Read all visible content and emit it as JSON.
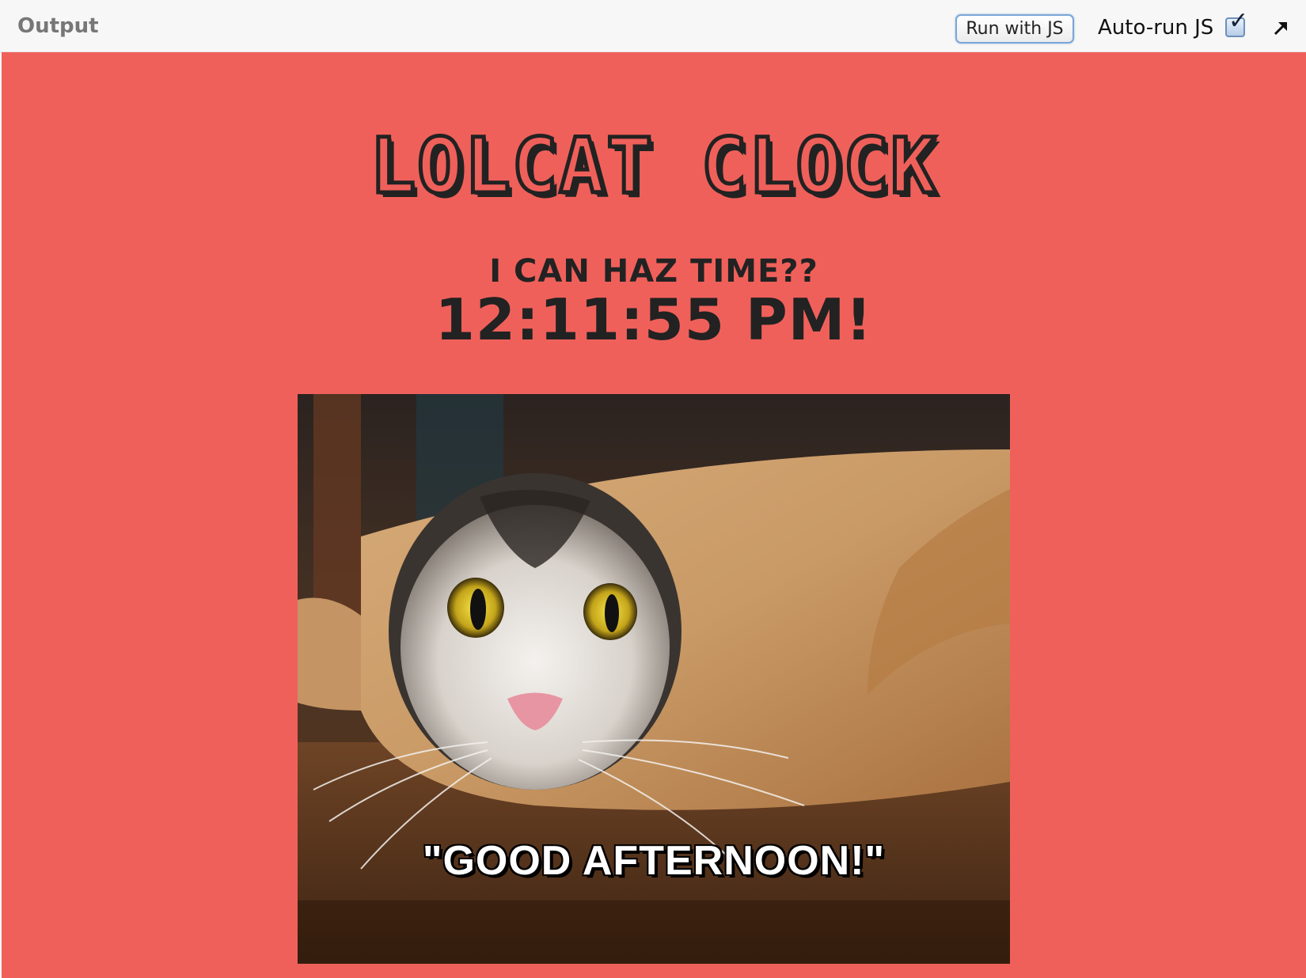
{
  "toolbar": {
    "title": "Output",
    "run_button_label": "Run with JS",
    "autorun_label": "Auto-run JS",
    "autorun_checked": true,
    "popout_icon": "external-link-arrow-icon"
  },
  "app": {
    "title": "LOLCAT CLOCK",
    "subtitle": "I CAN HAZ TIME??",
    "time": "12:11:55 PM!",
    "image": {
      "description_icon": "cat-in-paper-roll-photo",
      "caption": "\"GOOD AFTERNOON!\""
    }
  },
  "colors": {
    "background": "#f0605a",
    "text": "#222222",
    "toolbar": "#f7f7f7"
  }
}
